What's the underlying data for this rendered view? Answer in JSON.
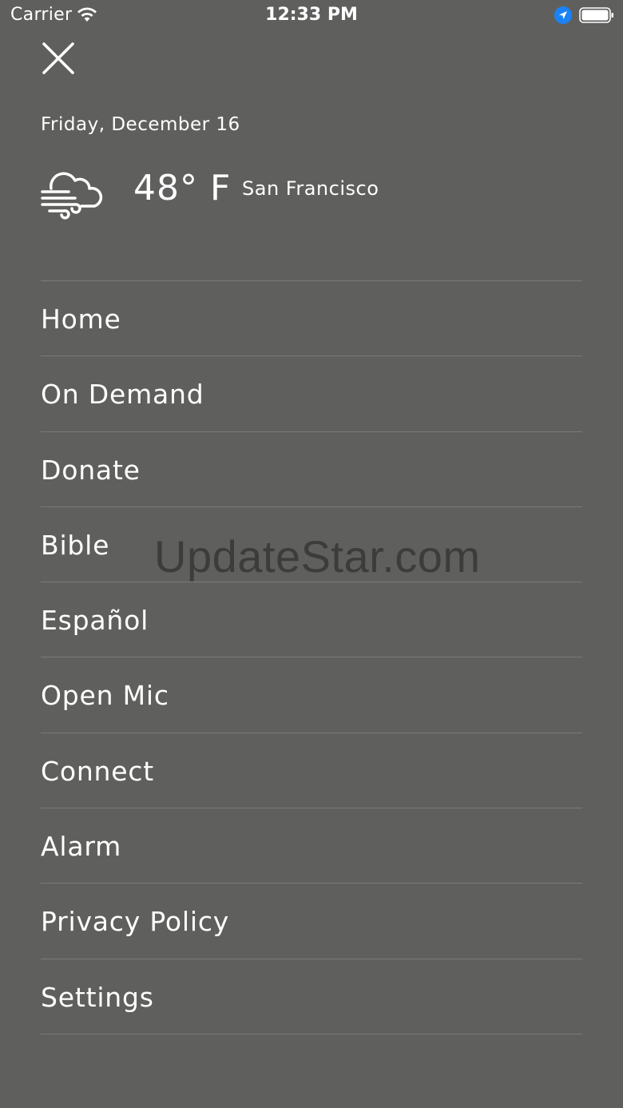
{
  "status_bar": {
    "carrier": "Carrier",
    "time": "12:33 PM",
    "wifi_icon": "wifi-icon",
    "location_icon": "location-arrow-icon",
    "battery_icon": "battery-full-icon",
    "location_color": "#1a82f7"
  },
  "header": {
    "close_icon": "close-icon",
    "date": "Friday, December 16",
    "weather_icon": "windy-cloud-icon",
    "temperature": "48° F",
    "city": "San Francisco"
  },
  "menu": {
    "items": [
      {
        "label": "Home"
      },
      {
        "label": "On Demand"
      },
      {
        "label": "Donate"
      },
      {
        "label": "Bible"
      },
      {
        "label": "Español"
      },
      {
        "label": "Open Mic"
      },
      {
        "label": "Connect"
      },
      {
        "label": "Alarm"
      },
      {
        "label": "Privacy Policy"
      },
      {
        "label": "Settings"
      }
    ]
  },
  "watermark": "UpdateStar.com",
  "colors": {
    "background": "#5f605e",
    "divider": "#7a7b79",
    "text": "#ffffff"
  }
}
